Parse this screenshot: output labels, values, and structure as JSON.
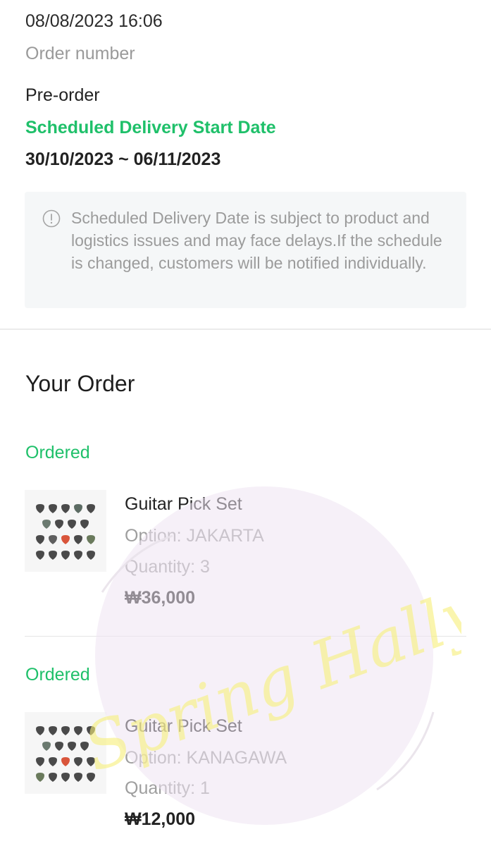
{
  "header": {
    "datetime": "08/08/2023 16:06",
    "order_number_label": "Order number"
  },
  "delivery": {
    "type": "Pre-order",
    "scheduled_title": "Scheduled Delivery Start Date",
    "date_range": "30/10/2023 ~ 06/11/2023",
    "notice_icon": "info-circle-icon",
    "notice": "Scheduled Delivery Date is subject to product and logistics issues and may face delays.If the schedule is changed, customers will be notified individually."
  },
  "order_section": {
    "title": "Your Order",
    "items": [
      {
        "status": "Ordered",
        "name": "Guitar Pick Set",
        "option": "Option: JAKARTA",
        "quantity": "Quantity: 3",
        "price": "₩36,000"
      },
      {
        "status": "Ordered",
        "name": "Guitar Pick Set",
        "option": "Option: KANAGAWA",
        "quantity": "Quantity: 1",
        "price": "₩12,000"
      }
    ]
  },
  "watermark": {
    "text": "Spring Hallyu"
  },
  "colors": {
    "accent_green": "#1fc06a",
    "muted_text": "#9b9b9b",
    "notice_bg": "#f5f7f8"
  }
}
